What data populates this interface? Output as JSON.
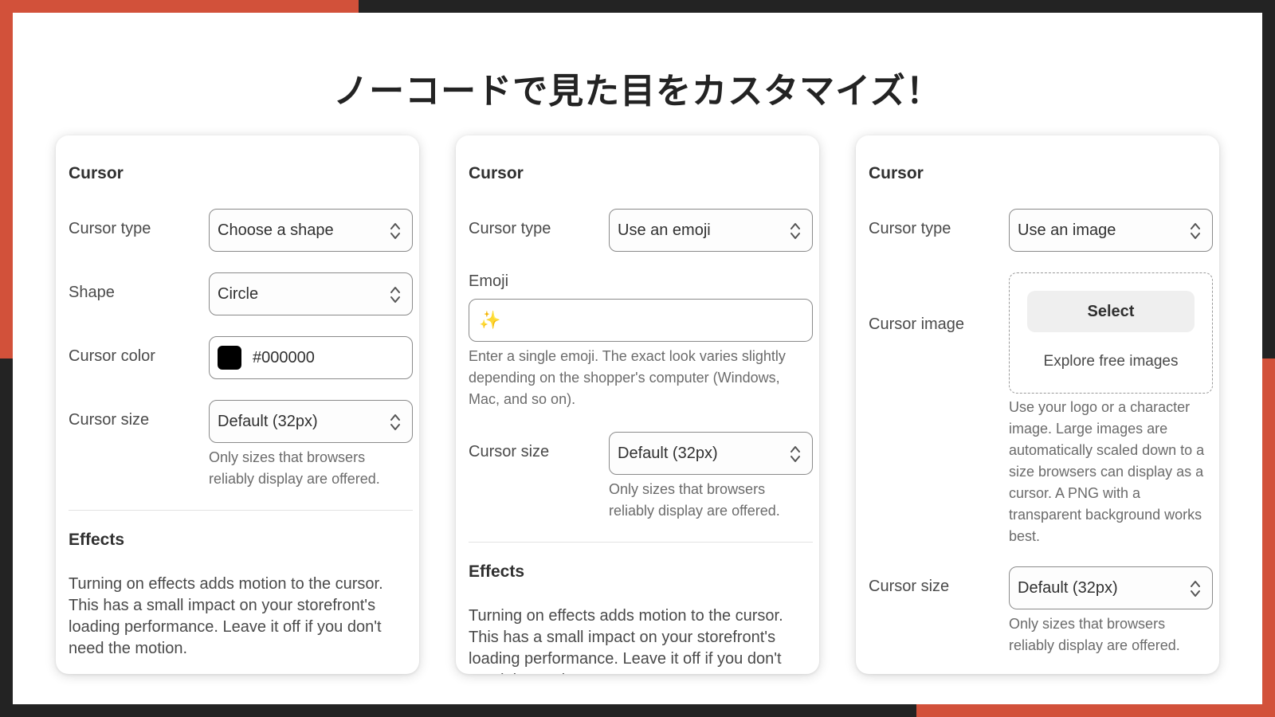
{
  "title": "ノーコードで見た目をカスタマイズ！",
  "colors": {
    "accent": "#d2513a",
    "frame": "#232323",
    "background": "#ffffff",
    "swatch": "#000000"
  },
  "icons": {
    "select_arrows": "chevron-up-down-icon",
    "emoji": "sparkles"
  },
  "cards": [
    {
      "section_title": "Cursor",
      "cursor_type_label": "Cursor type",
      "cursor_type_value": "Choose a shape",
      "shape_label": "Shape",
      "shape_value": "Circle",
      "color_label": "Cursor color",
      "color_value": "#000000",
      "size_label": "Cursor size",
      "size_value": "Default (32px)",
      "size_help": "Only sizes that browsers reliably display are offered.",
      "effects_title": "Effects",
      "effects_text": "Turning on effects adds motion to the cursor. This has a small impact on your storefront's loading performance. Leave it off if you don't need the motion."
    },
    {
      "section_title": "Cursor",
      "cursor_type_label": "Cursor type",
      "cursor_type_value": "Use an emoji",
      "emoji_label": "Emoji",
      "emoji_value": "✨",
      "emoji_help": "Enter a single emoji. The exact look varies slightly depending on the shopper's computer (Windows, Mac, and so on).",
      "size_label": "Cursor size",
      "size_value": "Default (32px)",
      "size_help": "Only sizes that browsers reliably display are offered.",
      "effects_title": "Effects",
      "effects_text": "Turning on effects adds motion to the cursor. This has a small impact on your storefront's loading performance. Leave it off if you don't need the motion."
    },
    {
      "section_title": "Cursor",
      "cursor_type_label": "Cursor type",
      "cursor_type_value": "Use an image",
      "image_label": "Cursor image",
      "select_button": "Select",
      "explore_link": "Explore free images",
      "image_help": "Use your logo or a character image. Large images are automatically scaled down to a size browsers can display as a cursor. A PNG with a transparent background works best.",
      "size_label": "Cursor size",
      "size_value": "Default (32px)",
      "size_help": "Only sizes that browsers reliably display are offered."
    }
  ]
}
